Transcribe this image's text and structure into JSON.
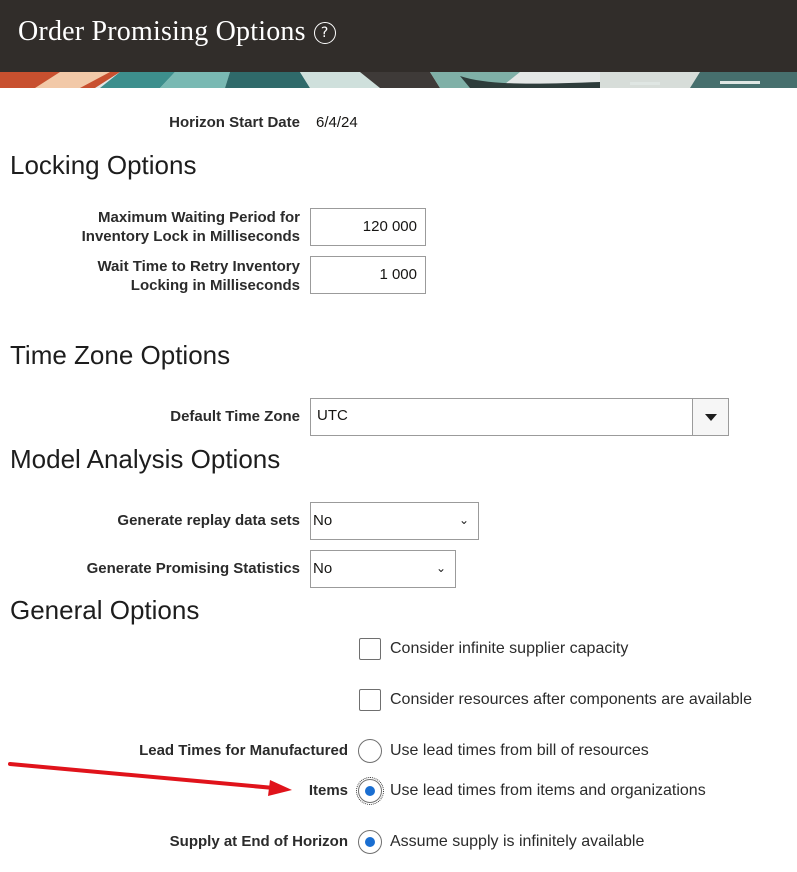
{
  "header": {
    "title": "Order Promising Options",
    "help_icon": "question-circle-icon"
  },
  "horizon": {
    "label": "Horizon Start Date",
    "value": "6/4/24"
  },
  "locking": {
    "title": "Locking Options",
    "max_wait_label_1": "Maximum Waiting Period for",
    "max_wait_label_2": "Inventory Lock in Milliseconds",
    "max_wait_value": "120 000",
    "retry_label_1": "Wait Time to Retry Inventory",
    "retry_label_2": "Locking in Milliseconds",
    "retry_value": "1 000"
  },
  "timezone": {
    "title": "Time Zone Options",
    "label": "Default Time Zone",
    "value": "UTC"
  },
  "model": {
    "title": "Model Analysis Options",
    "replay_label": "Generate replay data sets",
    "replay_value": "No",
    "stats_label": "Generate Promising Statistics",
    "stats_value": "No"
  },
  "general": {
    "title": "General Options",
    "infinite_supplier": "Consider infinite supplier capacity",
    "resources_after": "Consider resources after components are available",
    "lead_times_label_1": "Lead Times for Manufactured",
    "lead_times_label_2": "Items",
    "lead_option_bor": "Use lead times from bill of resources",
    "lead_option_items": "Use lead times from items and organizations",
    "supply_label": "Supply at End of Horizon",
    "supply_option": "Assume supply is infinitely available"
  },
  "colors": {
    "header_bg": "#312d2a",
    "radio_selected": "#1a6ed1",
    "annotation_arrow": "#e0131b"
  }
}
